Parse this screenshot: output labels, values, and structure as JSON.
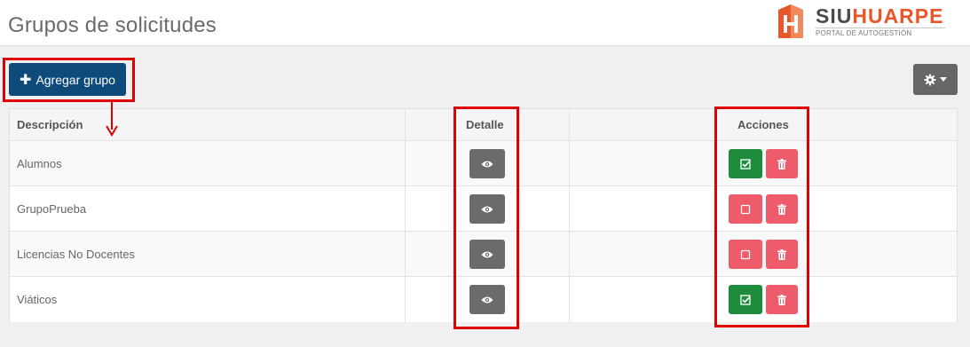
{
  "header": {
    "title": "Grupos de solicitudes",
    "logo": {
      "word_a": "SIU",
      "word_b": "HUARPE",
      "subtitle": "PORTAL DE AUTOGESTIÓN",
      "brand_color": "#e8562a"
    }
  },
  "toolbar": {
    "add_group_label": "Agregar grupo",
    "settings_icon": "gear-icon"
  },
  "table": {
    "columns": {
      "description": "Descripción",
      "detail": "Detalle",
      "actions": "Acciones"
    },
    "rows": [
      {
        "description": "Alumnos",
        "active": true
      },
      {
        "description": "GrupoPrueba",
        "active": false
      },
      {
        "description": "Licencias No Docentes",
        "active": false
      },
      {
        "description": "Viáticos",
        "active": true
      }
    ]
  },
  "colors": {
    "primary": "#0e4a7a",
    "success": "#1f8c3d",
    "danger": "#ee5b6b",
    "neutral": "#6b6b6b",
    "highlight": "#e00000"
  }
}
